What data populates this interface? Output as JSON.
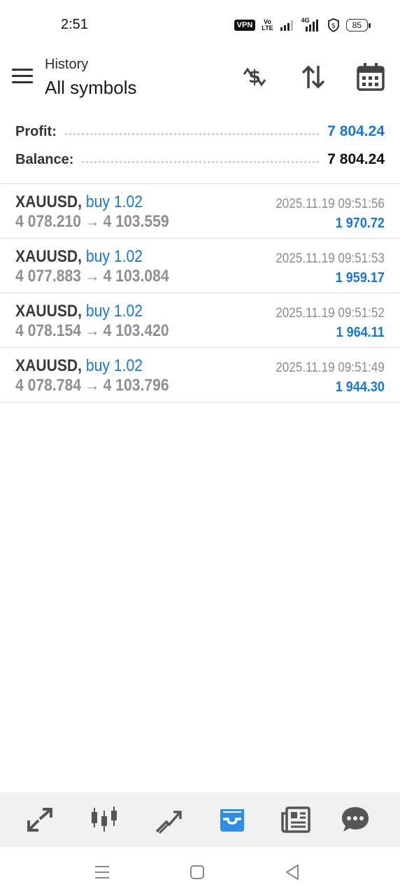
{
  "status_bar": {
    "time": "2:51",
    "vpn_label": "VPN",
    "volte_label": "Vo\nLTE",
    "network_label": "4G",
    "battery_level": "85"
  },
  "header": {
    "subtitle": "History",
    "title": "All symbols",
    "icons": [
      "currency-exchange-icon",
      "sort-icon",
      "calendar-icon"
    ]
  },
  "summary": {
    "profit_label": "Profit:",
    "profit_value": "7 804.24",
    "balance_label": "Balance:",
    "balance_value": "7 804.24"
  },
  "trades": [
    {
      "symbol": "XAUUSD,",
      "type": "buy 1.02",
      "open_price": "4 078.210",
      "close_price": "4 103.559",
      "time": "2025.11.19 09:51:56",
      "profit": "1 970.72"
    },
    {
      "symbol": "XAUUSD,",
      "type": "buy 1.02",
      "open_price": "4 077.883",
      "close_price": "4 103.084",
      "time": "2025.11.19 09:51:53",
      "profit": "1 959.17"
    },
    {
      "symbol": "XAUUSD,",
      "type": "buy 1.02",
      "open_price": "4 078.154",
      "close_price": "4 103.420",
      "time": "2025.11.19 09:51:52",
      "profit": "1 964.11"
    },
    {
      "symbol": "XAUUSD,",
      "type": "buy 1.02",
      "open_price": "4 078.784",
      "close_price": "4 103.796",
      "time": "2025.11.19 09:51:49",
      "profit": "1 944.30"
    }
  ],
  "arrow_glyph": "→",
  "bottom_nav": {
    "items": [
      "quotes-icon",
      "chart-icon",
      "trade-icon",
      "history-icon",
      "news-icon",
      "chat-icon"
    ],
    "active": "history-icon"
  },
  "system_nav": [
    "recents-icon",
    "home-icon",
    "back-icon"
  ],
  "colors": {
    "accent": "#1976d2",
    "muted_price": "#8f8f8f",
    "nav_background": "#f0f0f0",
    "active_nav": "#2f8de4"
  }
}
